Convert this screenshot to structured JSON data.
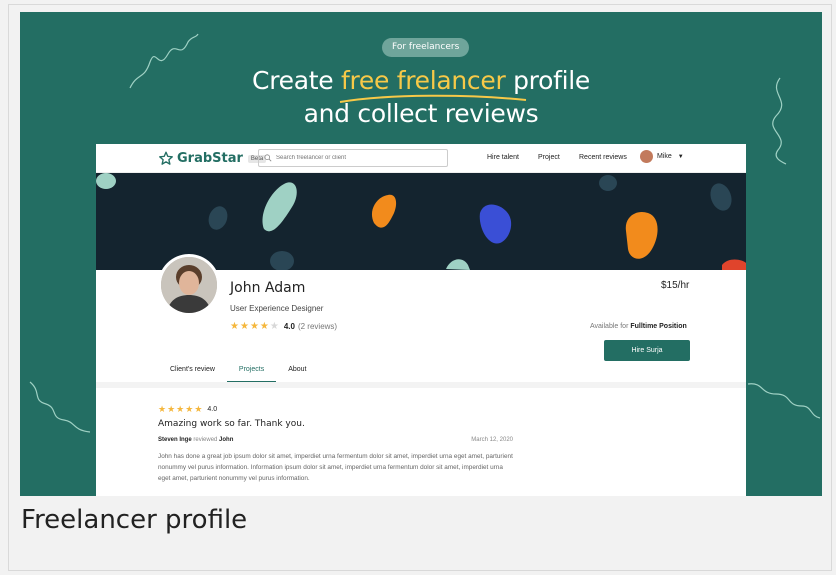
{
  "hero": {
    "badge": "For freelancers",
    "headline_part1": "Create ",
    "headline_highlight": "free frelancer",
    "headline_part2": " profile",
    "headline_line2": "and collect reviews"
  },
  "nav": {
    "logo": "GrabStar",
    "beta": "Beta",
    "search_placeholder": "Search freelancer or client",
    "links": [
      "Hire talent",
      "Project",
      "Recent reviews"
    ],
    "user": "Mike"
  },
  "profile": {
    "name": "John Adam",
    "title": "User Experience Designer",
    "rating": "4.0",
    "reviews": "(2 reviews)",
    "rate": "$15/hr",
    "available_prefix": "Available for",
    "available_value": "Fulltime Position",
    "hire_button": "Hire Surja"
  },
  "tabs": [
    "Client's review",
    "Projects",
    "About"
  ],
  "review": {
    "rating": "4.0",
    "title": "Amazing work so far. Thank you.",
    "reviewer": "Steven Inge",
    "action": "reviewed",
    "reviewee": "John",
    "date": "March 12, 2020",
    "body": "John has done a great job  ipsum dolor sit amet, imperdiet urna fermentum dolor sit amet, imperdiet urna eget amet, parturient nonummy vel purus information. Information ipsum dolor sit amet, imperdiet urna fermentum dolor sit amet, imperdiet urna eget amet, parturient nonummy vel purus information."
  },
  "caption": "Freelancer profile",
  "colors": {
    "brand": "#236e63",
    "highlight": "#f7c948",
    "star": "#f5b73d",
    "cover": "#14242f"
  }
}
